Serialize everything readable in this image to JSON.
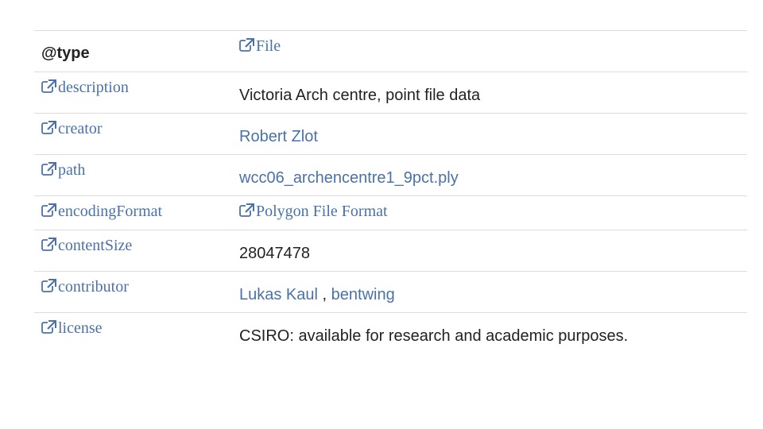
{
  "rows": [
    {
      "key": "@type",
      "value": "File"
    },
    {
      "key": "description",
      "value": "Victoria Arch centre, point file data"
    },
    {
      "key": "creator",
      "value": "Robert Zlot"
    },
    {
      "key": "path",
      "value": "wcc06_archencentre1_9pct.ply"
    },
    {
      "key": "encodingFormat",
      "value": "Polygon File Format"
    },
    {
      "key": "contentSize",
      "value": "28047478"
    },
    {
      "key": "contributor",
      "value": [
        "Lukas Kaul",
        "bentwing"
      ],
      "separator": " , "
    },
    {
      "key": "license",
      "value": "CSIRO: available for research and academic purposes."
    }
  ],
  "colors": {
    "link": "#4a72a8",
    "text": "#222222",
    "border": "#dcdcdc"
  },
  "icon": "external-link-icon"
}
